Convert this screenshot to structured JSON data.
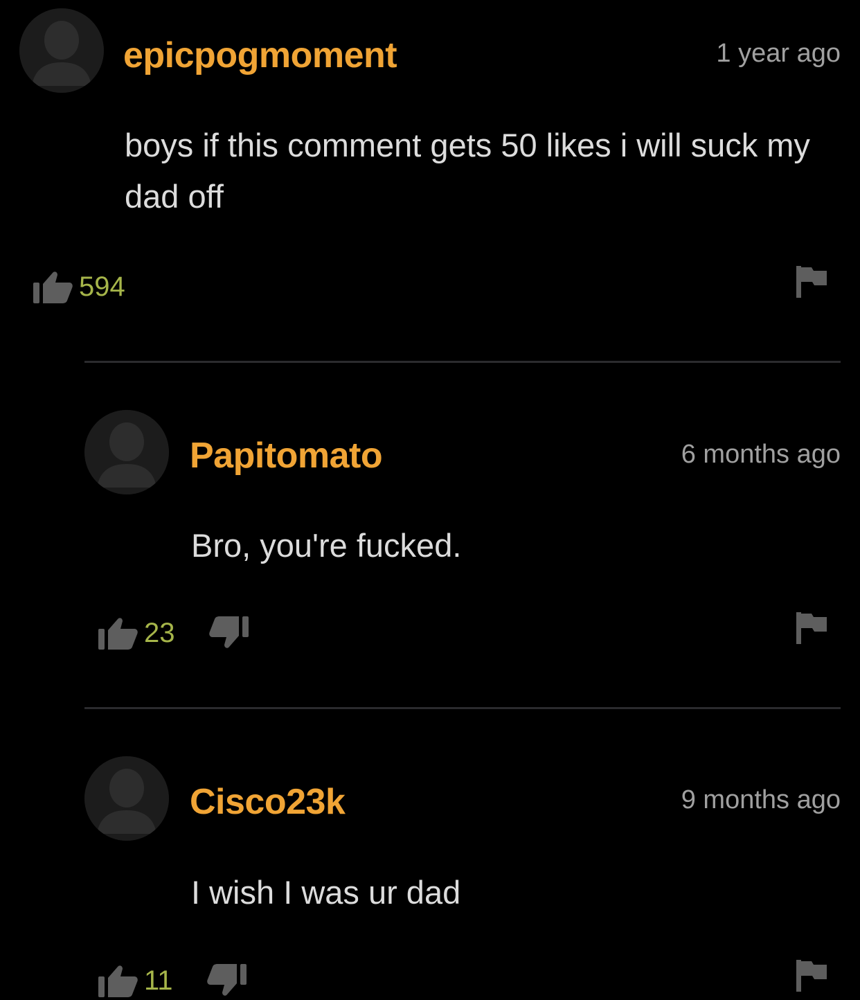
{
  "comments": [
    {
      "username": "epicpogmoment",
      "timestamp": "1 year ago",
      "body": "boys if this comment gets 50 likes i will suck my dad off",
      "likes": "594",
      "has_dislike": false
    },
    {
      "username": "Papitomato",
      "timestamp": "6 months ago",
      "body": "Bro, you're fucked.",
      "likes": "23",
      "has_dislike": true
    },
    {
      "username": "Cisco23k",
      "timestamp": "9 months ago",
      "body": "I wish I was ur dad",
      "likes": "11",
      "has_dislike": true
    }
  ],
  "colors": {
    "background": "#000000",
    "username": "#f0a435",
    "like_count": "#a6b54a",
    "timestamp": "#a0a0a0",
    "icon": "#5e5e5e"
  },
  "icons": {
    "avatar": "default-user-avatar",
    "like": "thumbs-up-icon",
    "dislike": "thumbs-down-icon",
    "report": "flag-icon"
  }
}
